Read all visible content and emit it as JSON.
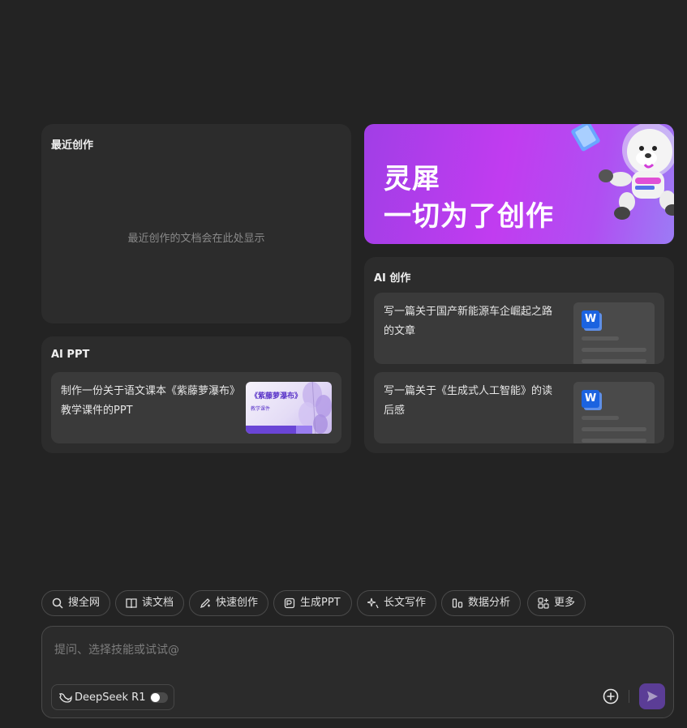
{
  "recent": {
    "title": "最近创作",
    "empty_text": "最近创作的文档会在此处显示"
  },
  "ai_ppt": {
    "title": "AI PPT",
    "item_text": "制作一份关于语文课本《紫藤萝瀑布》教学课件的PPT",
    "thumb_title": "《紫藤萝瀑布》",
    "thumb_subtitle": "教学课件"
  },
  "banner": {
    "line1": "灵犀",
    "line2": "一切为了创作"
  },
  "ai_create": {
    "title": "AI 创作",
    "items": [
      {
        "text": "写一篇关于国产新能源车企崛起之路的文章",
        "icon": "word-doc-icon"
      },
      {
        "text": "写一篇关于《生成式人工智能》的读后感",
        "icon": "word-doc-icon"
      }
    ],
    "doc_badge": "W"
  },
  "skills": [
    {
      "label": "搜全网",
      "icon": "search-web-icon"
    },
    {
      "label": "读文档",
      "icon": "read-doc-icon"
    },
    {
      "label": "快速创作",
      "icon": "quick-write-icon"
    },
    {
      "label": "生成PPT",
      "icon": "ppt-icon"
    },
    {
      "label": "长文写作",
      "icon": "sparkle-icon"
    },
    {
      "label": "数据分析",
      "icon": "chart-icon"
    },
    {
      "label": "更多",
      "icon": "grid-plus-icon"
    }
  ],
  "composer": {
    "placeholder": "提问、选择技能或试试@",
    "model_name": "DeepSeek R1",
    "model_toggle_on": false
  },
  "colors": {
    "background": "#232323",
    "card": "#2c2c2c",
    "accent": "#5b3d96",
    "banner_start": "#a13ee6",
    "banner_end": "#9c7bf5"
  }
}
